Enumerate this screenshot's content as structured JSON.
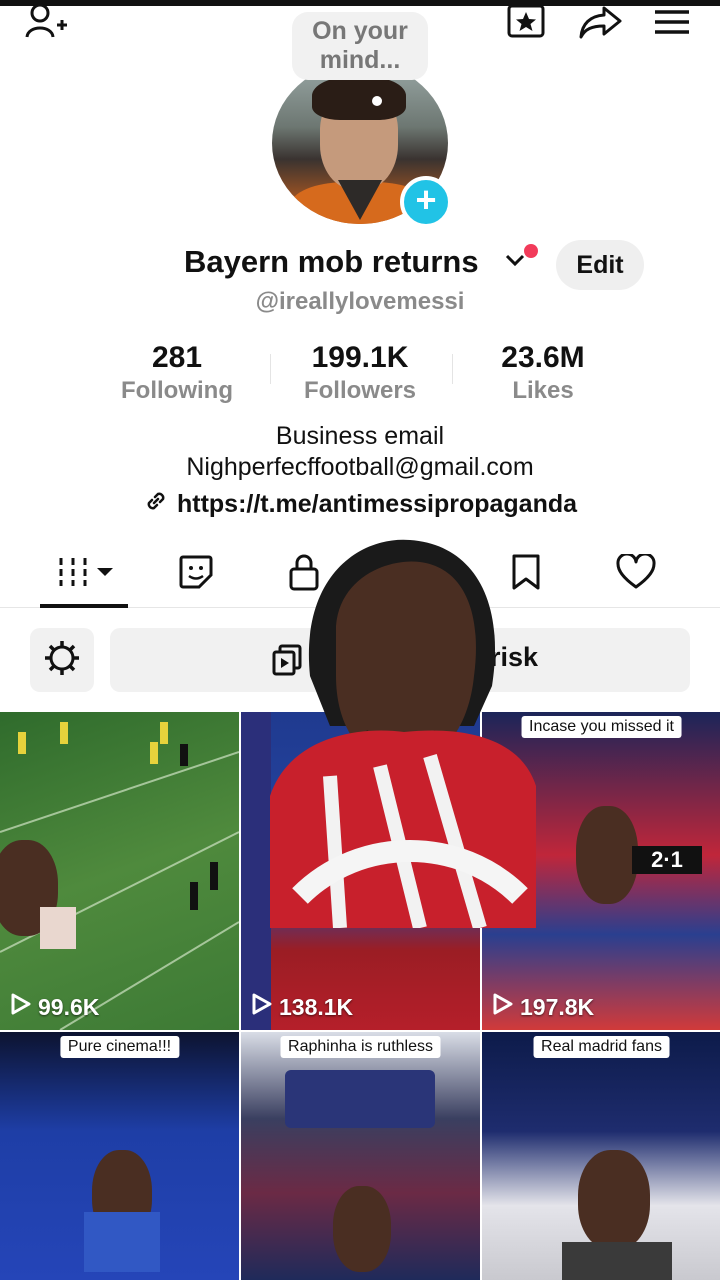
{
  "header": {
    "status_bubble": "On your\nmind...",
    "username": "Bayern mob returns",
    "handle": "@ireallylovemessi",
    "edit_label": "Edit"
  },
  "stats": [
    {
      "value": "281",
      "label": "Following"
    },
    {
      "value": "199.1K",
      "label": "Followers"
    },
    {
      "value": "23.6M",
      "label": "Likes"
    }
  ],
  "bio": {
    "line1": "Business email",
    "line2": "Nighperfecffootball@gmail.com",
    "link": "https://t.me/antimessipropaganda"
  },
  "promo": {
    "visible_tail": "n risk"
  },
  "videos": [
    {
      "caption": "",
      "views": "99.6K"
    },
    {
      "caption": "",
      "views": "138.1K"
    },
    {
      "caption": "Incase you missed it",
      "views": "197.8K"
    },
    {
      "caption": "Pure cinema!!!",
      "views": ""
    },
    {
      "caption": "Raphinha is ruthless",
      "views": ""
    },
    {
      "caption": "Real madrid fans",
      "views": ""
    }
  ],
  "colors": {
    "accent_cyan": "#21c3e6",
    "notify_red": "#f23b5a",
    "muted_text": "#8a8a8a"
  },
  "icons": [
    "add-friend-icon",
    "favorites-icon",
    "share-icon",
    "menu-icon",
    "plus-icon",
    "chevron-down-icon",
    "link-icon",
    "videos-grid-icon",
    "sticker-icon",
    "lock-icon",
    "bookmark-icon",
    "heart-icon",
    "settings-gear-icon",
    "promote-icon",
    "play-icon"
  ]
}
